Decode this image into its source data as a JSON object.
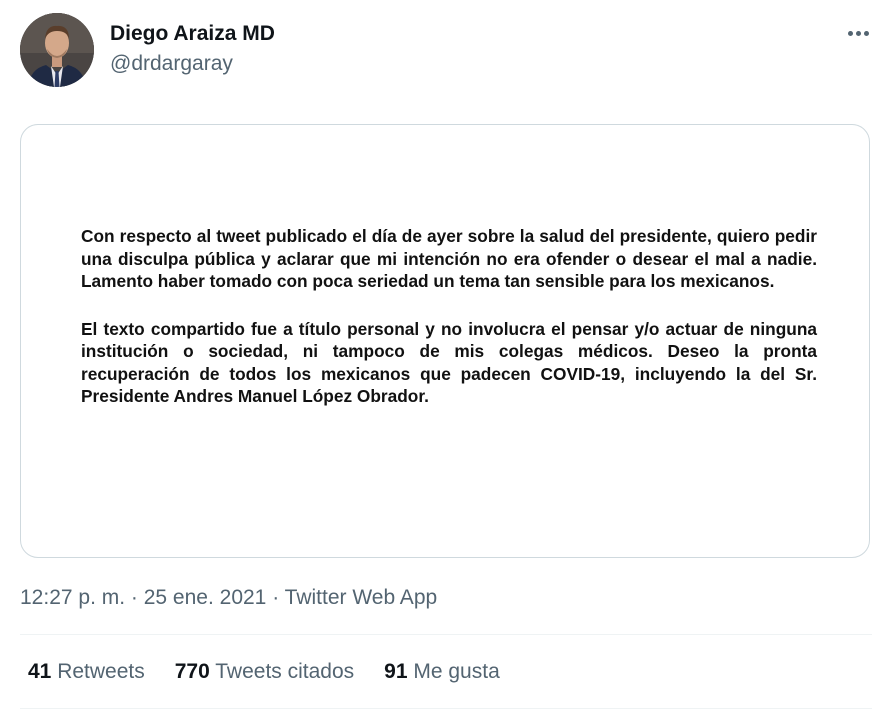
{
  "author": {
    "name": "Diego Araiza MD",
    "handle": "@drdargaray",
    "avatar_icon": "profile-photo"
  },
  "more_icon": "more-horizontal-icon",
  "image_text": {
    "paragraph1": "Con respecto al tweet publicado el día de ayer sobre la salud del presidente, quiero pedir una disculpa pública y aclarar que mi intención no era ofender o desear el mal a nadie. Lamento haber tomado con poca seriedad un tema tan sensible para los mexicanos.",
    "paragraph2": "El texto compartido fue a título personal y no involucra el pensar y/o actuar de ninguna institución o sociedad, ni tampoco de mis colegas médicos. Deseo la pronta recuperación de todos los mexicanos que padecen COVID-19, incluyendo la del Sr. Presidente Andres Manuel López Obrador."
  },
  "meta": {
    "time": "12:27 p. m.",
    "separator": " · ",
    "date": "25 ene. 2021",
    "source": "Twitter Web App"
  },
  "stats": {
    "retweets": {
      "count": "41",
      "label": "Retweets"
    },
    "quotes": {
      "count": "770",
      "label": "Tweets citados"
    },
    "likes": {
      "count": "91",
      "label": "Me gusta"
    }
  },
  "colors": {
    "primary_text": "#0f1419",
    "secondary_text": "#536471",
    "border": "#cfd9de"
  }
}
